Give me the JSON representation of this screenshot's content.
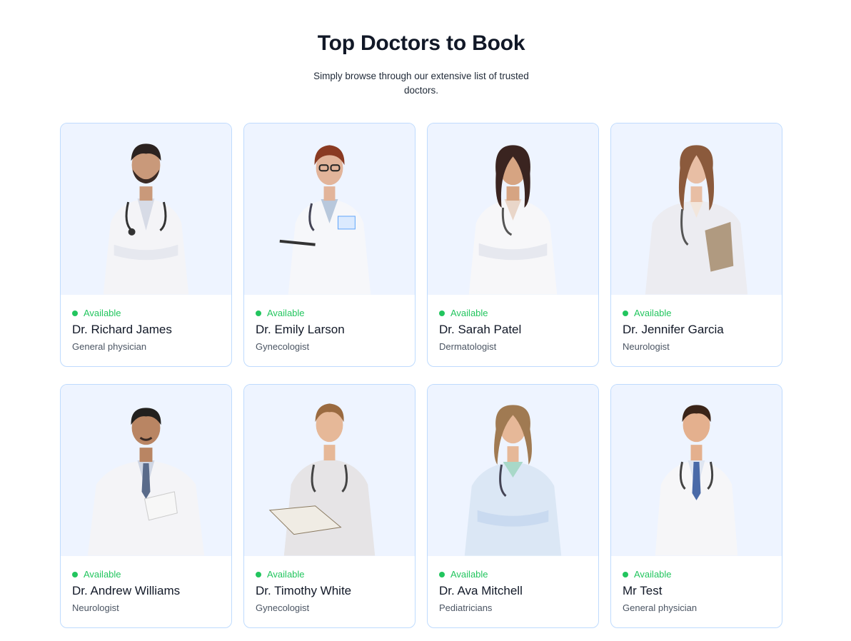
{
  "header": {
    "title": "Top Doctors to Book",
    "subtitle": "Simply browse through our extensive list of trusted doctors."
  },
  "colors": {
    "accent": "#22c55e",
    "card_border": "#bfdbfe",
    "photo_bg": "#eef4ff"
  },
  "doctors": [
    {
      "status": "Available",
      "name": "Dr. Richard James",
      "speciality": "General physician"
    },
    {
      "status": "Available",
      "name": "Dr. Emily Larson",
      "speciality": "Gynecologist"
    },
    {
      "status": "Available",
      "name": "Dr. Sarah Patel",
      "speciality": "Dermatologist"
    },
    {
      "status": "Available",
      "name": "Dr. Jennifer Garcia",
      "speciality": "Neurologist"
    },
    {
      "status": "Available",
      "name": "Dr. Andrew Williams",
      "speciality": "Neurologist"
    },
    {
      "status": "Available",
      "name": "Dr. Timothy White",
      "speciality": "Gynecologist"
    },
    {
      "status": "Available",
      "name": "Dr. Ava Mitchell",
      "speciality": "Pediatricians"
    },
    {
      "status": "Available",
      "name": "Mr Test",
      "speciality": "General physician"
    }
  ]
}
